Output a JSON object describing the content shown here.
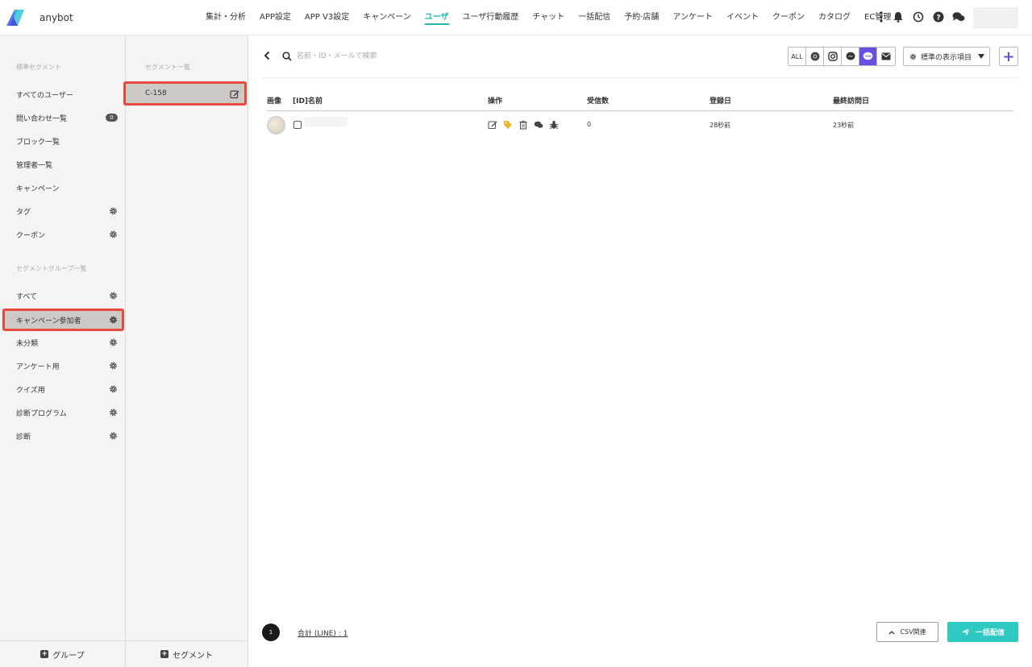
{
  "header": {
    "brand": "anybot",
    "nav": [
      {
        "label": "集計・分析"
      },
      {
        "label": "APP設定"
      },
      {
        "label": "APP V3設定"
      },
      {
        "label": "キャンペーン"
      },
      {
        "label": "ユーザ",
        "active": true
      },
      {
        "label": "ユーザ行動履歴"
      },
      {
        "label": "チャット"
      },
      {
        "label": "一括配信"
      },
      {
        "label": "予約·店舗"
      },
      {
        "label": "アンケート"
      },
      {
        "label": "イベント"
      },
      {
        "label": "クーポン"
      },
      {
        "label": "カタログ"
      },
      {
        "label": "EC管理"
      }
    ],
    "icons": [
      "more-vertical-icon",
      "bell-icon",
      "history-icon",
      "help-icon",
      "chat-icon"
    ]
  },
  "sidebar": {
    "standard_title": "標準セグメント",
    "standard_items": [
      {
        "label": "すべてのユーザー"
      },
      {
        "label": "問い合わせ一覧",
        "badge": "0"
      },
      {
        "label": "ブロック一覧"
      },
      {
        "label": "管理者一覧"
      },
      {
        "label": "キャンペーン"
      },
      {
        "label": "タグ",
        "gear": true
      },
      {
        "label": "クーポン",
        "gear": true
      }
    ],
    "group_title": "セグメントグループ一覧",
    "group_items": [
      {
        "label": "すべて"
      },
      {
        "label": "キャンペーン参加者",
        "selected": true
      },
      {
        "label": "未分類"
      },
      {
        "label": "アンケート用"
      },
      {
        "label": "クイズ用"
      },
      {
        "label": "診断プログラム"
      },
      {
        "label": "診断"
      }
    ],
    "footer_label": "グループ"
  },
  "segments": {
    "title": "セグメント一覧",
    "items": [
      {
        "label": "C-158"
      }
    ],
    "footer_label": "セグメント"
  },
  "main": {
    "search_placeholder": "名前・ID・メールで検索",
    "channels": [
      "ALL",
      "chrome-icon",
      "instagram-icon",
      "messenger-icon",
      "line-icon",
      "mail-icon"
    ],
    "active_channel": "line-icon",
    "display_select": "標準の表示項目",
    "columns": [
      "画像",
      "[ID]名前",
      "操作",
      "受信数",
      "登録日",
      "最終訪問日"
    ],
    "rows": [
      {
        "received": "0",
        "registered": "28秒前",
        "last_visit": "23秒前"
      }
    ],
    "page": "1",
    "total": "合計 (LINE) : 1",
    "csv_label": "CSV関連",
    "bulk_label": "一括配信"
  },
  "colors": {
    "accent": "#20b9b3",
    "highlight": "#e5483f",
    "line_active": "#6b4fe0",
    "bulk": "#2ec9c0"
  }
}
